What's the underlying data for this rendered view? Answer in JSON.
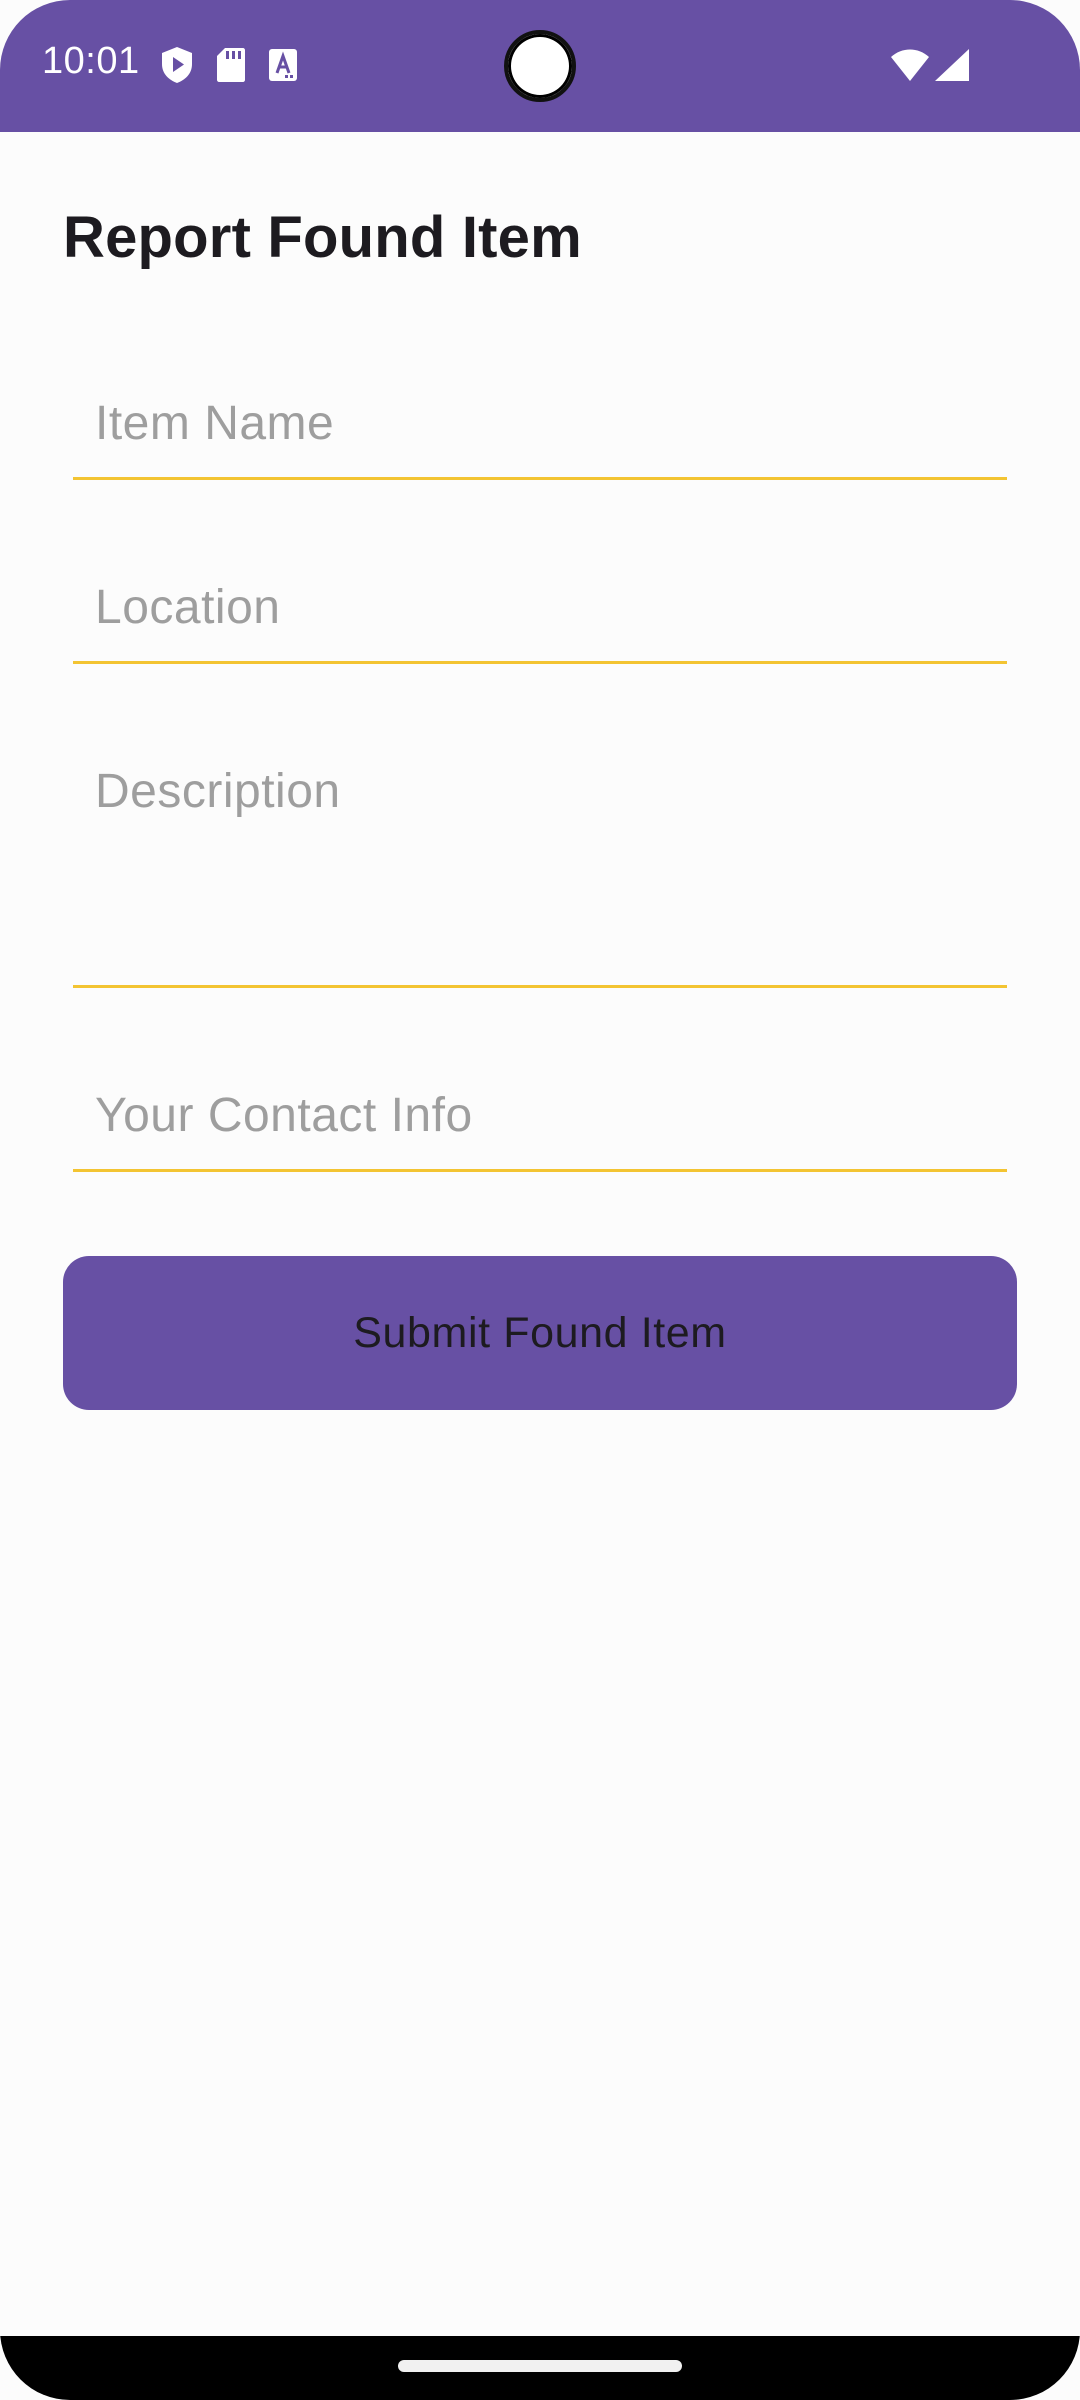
{
  "status_bar": {
    "time": "10:01",
    "left_icons": [
      "shield-play-icon",
      "sd-card-icon",
      "text-a-icon"
    ],
    "right_icons": [
      "wifi-icon",
      "cell-signal-icon"
    ],
    "color": "#6750a4"
  },
  "page": {
    "title": "Report Found Item"
  },
  "form": {
    "item_name_placeholder": "Item Name",
    "location_placeholder": "Location",
    "description_placeholder": "Description",
    "contact_placeholder": "Your Contact Info",
    "underline_color": "#f3c432"
  },
  "actions": {
    "submit_label": "Submit Found Item",
    "button_color": "#6750a4"
  }
}
